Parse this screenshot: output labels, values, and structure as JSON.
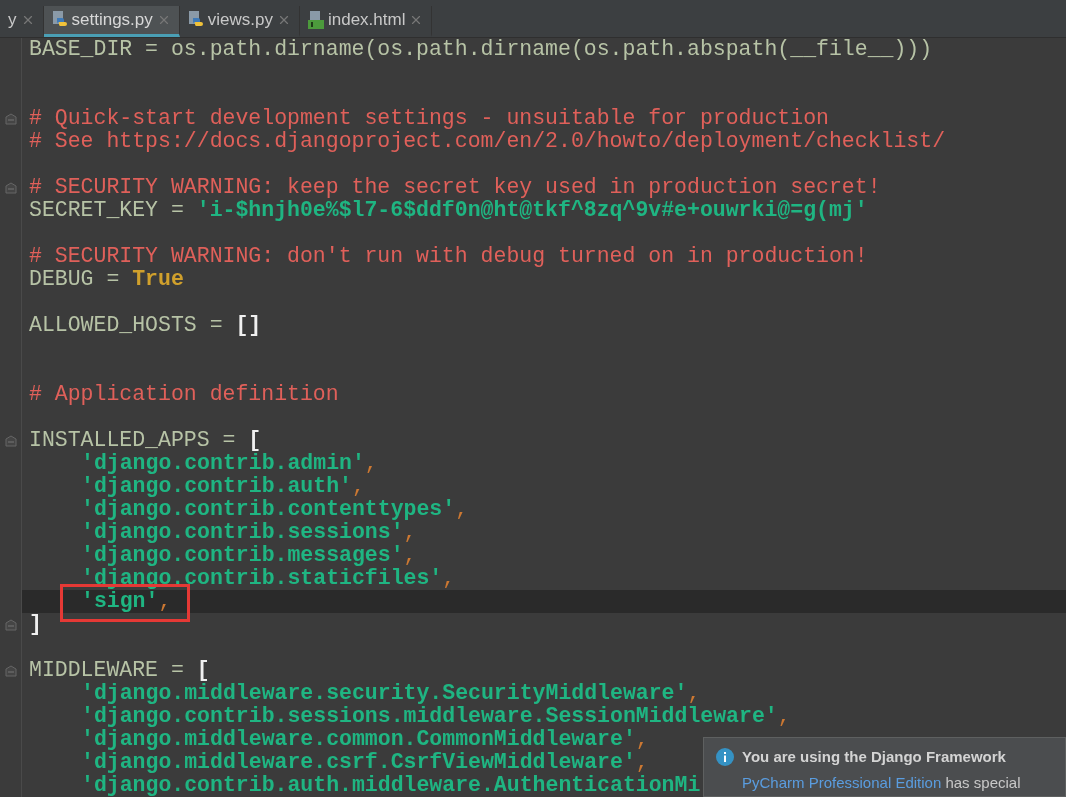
{
  "tabs": [
    {
      "label": "y",
      "selected": false,
      "kind": "plain"
    },
    {
      "label": "settings.py",
      "selected": true,
      "kind": "python"
    },
    {
      "label": "views.py",
      "selected": false,
      "kind": "python"
    },
    {
      "label": "index.html",
      "selected": false,
      "kind": "html"
    }
  ],
  "lines": [
    {
      "kind": "code",
      "tokens": [
        {
          "kind": "plain",
          "text": "BASE_DIR = os.path.dirname(os.path.dirname(os.path.abspath(__file__)))"
        }
      ]
    },
    {
      "kind": "blank"
    },
    {
      "kind": "blank"
    },
    {
      "kind": "code",
      "fold": true,
      "tokens": [
        {
          "kind": "comment",
          "text": "# Quick-start development settings - unsuitable for production"
        }
      ]
    },
    {
      "kind": "code",
      "tokens": [
        {
          "kind": "comment",
          "text": "# See https://docs.djangoproject.com/en/2.0/howto/deployment/checklist/"
        }
      ]
    },
    {
      "kind": "blank"
    },
    {
      "kind": "code",
      "fold": true,
      "tokens": [
        {
          "kind": "comment",
          "text": "# SECURITY WARNING: keep the secret key used in production secret!"
        }
      ]
    },
    {
      "kind": "code",
      "tokens": [
        {
          "kind": "plain",
          "text": "SECRET_KEY = "
        },
        {
          "kind": "string",
          "text": "'i-$hnjh0e%$l7-6$ddf0n@ht@tkf^8zq^9v#e+ouwrki@=g(mj'"
        }
      ]
    },
    {
      "kind": "blank"
    },
    {
      "kind": "code",
      "tokens": [
        {
          "kind": "comment",
          "text": "# SECURITY WARNING: don't run with debug turned on in production!"
        }
      ]
    },
    {
      "kind": "code",
      "tokens": [
        {
          "kind": "plain",
          "text": "DEBUG = "
        },
        {
          "kind": "keyword",
          "text": "True"
        }
      ]
    },
    {
      "kind": "blank"
    },
    {
      "kind": "code",
      "tokens": [
        {
          "kind": "plain",
          "text": "ALLOWED_HOSTS = "
        },
        {
          "kind": "bracket",
          "text": "[]"
        }
      ]
    },
    {
      "kind": "blank"
    },
    {
      "kind": "blank"
    },
    {
      "kind": "code",
      "tokens": [
        {
          "kind": "comment",
          "text": "# Application definition"
        }
      ]
    },
    {
      "kind": "blank"
    },
    {
      "kind": "code",
      "fold": true,
      "tokens": [
        {
          "kind": "plain",
          "text": "INSTALLED_APPS = "
        },
        {
          "kind": "bracket",
          "text": "["
        }
      ]
    },
    {
      "kind": "code",
      "indented": true,
      "tokens": [
        {
          "kind": "string",
          "text": "'django.contrib.admin'"
        },
        {
          "kind": "punct",
          "text": ","
        }
      ]
    },
    {
      "kind": "code",
      "indented": true,
      "tokens": [
        {
          "kind": "string",
          "text": "'django.contrib.auth'"
        },
        {
          "kind": "punct",
          "text": ","
        }
      ]
    },
    {
      "kind": "code",
      "indented": true,
      "tokens": [
        {
          "kind": "string",
          "text": "'django.contrib.contenttypes'"
        },
        {
          "kind": "punct",
          "text": ","
        }
      ]
    },
    {
      "kind": "code",
      "indented": true,
      "tokens": [
        {
          "kind": "string",
          "text": "'django.contrib.sessions'"
        },
        {
          "kind": "punct",
          "text": ","
        }
      ]
    },
    {
      "kind": "code",
      "indented": true,
      "tokens": [
        {
          "kind": "string",
          "text": "'django.contrib.messages'"
        },
        {
          "kind": "punct",
          "text": ","
        }
      ]
    },
    {
      "kind": "code",
      "indented": true,
      "tokens": [
        {
          "kind": "string",
          "text": "'django.contrib.staticfiles'"
        },
        {
          "kind": "punct",
          "text": ","
        }
      ]
    },
    {
      "kind": "code",
      "indented": true,
      "current": true,
      "boxed": true,
      "tokens": [
        {
          "kind": "string",
          "text": "'sign'"
        },
        {
          "kind": "punct",
          "text": ","
        }
      ]
    },
    {
      "kind": "code",
      "fold": true,
      "tokens": [
        {
          "kind": "bracket",
          "text": "]"
        }
      ]
    },
    {
      "kind": "blank"
    },
    {
      "kind": "code",
      "fold": true,
      "tokens": [
        {
          "kind": "plain",
          "text": "MIDDLEWARE = "
        },
        {
          "kind": "bracket",
          "text": "["
        }
      ]
    },
    {
      "kind": "code",
      "indented": true,
      "tokens": [
        {
          "kind": "string",
          "text": "'django.middleware.security.SecurityMiddleware'"
        },
        {
          "kind": "punct",
          "text": ","
        }
      ]
    },
    {
      "kind": "code",
      "indented": true,
      "tokens": [
        {
          "kind": "string",
          "text": "'django.contrib.sessions.middleware.SessionMiddleware'"
        },
        {
          "kind": "punct",
          "text": ","
        }
      ]
    },
    {
      "kind": "code",
      "indented": true,
      "tokens": [
        {
          "kind": "string",
          "text": "'django.middleware.common.CommonMiddleware'"
        },
        {
          "kind": "punct",
          "text": ","
        }
      ]
    },
    {
      "kind": "code",
      "indented": true,
      "tokens": [
        {
          "kind": "string",
          "text": "'django.middleware.csrf.CsrfViewMiddleware'"
        },
        {
          "kind": "punct",
          "text": ","
        }
      ]
    },
    {
      "kind": "code",
      "indented": true,
      "tokens": [
        {
          "kind": "string",
          "text": "'django.contrib.auth.middleware.AuthenticationMi"
        }
      ]
    }
  ],
  "notification": {
    "title": "You are using the Django Framework",
    "link": "PyCharm Professional Edition",
    "text": " has special"
  }
}
